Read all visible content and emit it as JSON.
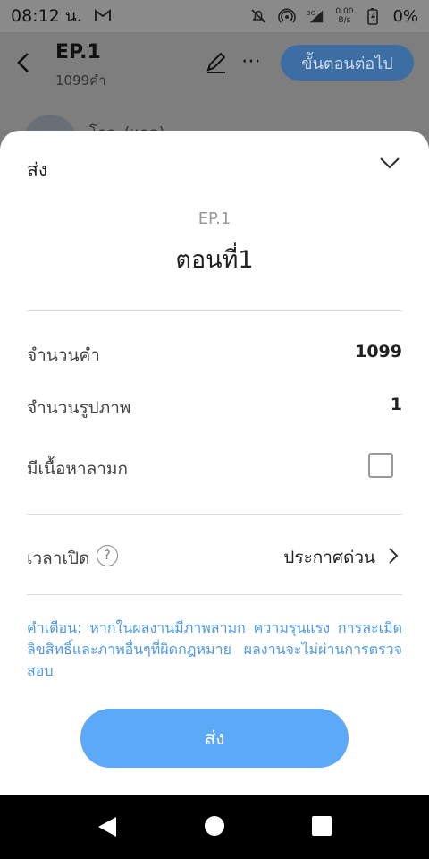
{
  "status_bar": {
    "time": "08:12 น.",
    "mail_icon": "gmail-icon",
    "net_speed_top": "0.00",
    "net_speed_bottom": "B/s",
    "network_type": "3G",
    "battery_percent": "0%"
  },
  "header": {
    "title": "EP.1",
    "subtitle": "1099คำ",
    "next_label": "ขั้นตอนต่อไป",
    "author_name": "โอกะ(แอด)"
  },
  "sheet": {
    "title": "ส่ง",
    "episode_label": "EP.1",
    "episode_name": "ตอนที่1",
    "word_count_label": "จำนวนคำ",
    "word_count_value": "1099",
    "image_count_label": "จำนวนรูปภาพ",
    "image_count_value": "1",
    "mature_label": "มีเนื้อหาลามก",
    "mature_checked": false,
    "open_time_label": "เวลาเปิด",
    "help_symbol": "?",
    "open_time_value": "ประกาศด่วน",
    "warning_text": "คำเตือน: หากในผลงานมีภาพลามก ความรุนแรง การละเมิดลิขสิทธิ์และภาพอื่นๆที่ผิดกฎหมาย ผลงานจะไม่ผ่านการตรวจสอบ",
    "send_label": "ส่ง"
  },
  "colors": {
    "accent": "#5caaf7",
    "warning": "#4d9ae8",
    "next_button_dimmed": "#3c6ea3"
  }
}
